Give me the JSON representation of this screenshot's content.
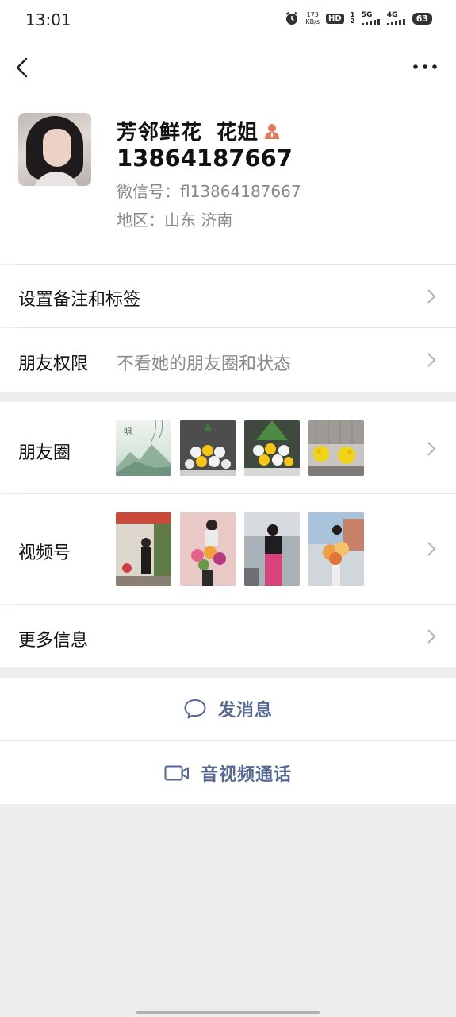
{
  "status_bar": {
    "time": "13:01",
    "net_speed_value": "173",
    "net_speed_unit": "KB/s",
    "hd_label": "HD",
    "hd_sub": "1 2",
    "signal1_label": "5G",
    "signal2_label": "4G",
    "battery": "63"
  },
  "nav": {
    "back_icon": "chevron-left-icon",
    "more_icon": "more-dots-icon"
  },
  "profile": {
    "name": "芳邻鲜花",
    "name_suffix": "花姐",
    "phone": "13864187667",
    "wechat_id": "微信号：fl13864187667",
    "region": "地区：山东  济南"
  },
  "rows": {
    "remark_label": "设置备注和标签",
    "permission_label": "朋友权限",
    "permission_value": "不看她的朋友圈和状态",
    "moments_label": "朋友圈",
    "channels_label": "视频号",
    "more_info_label": "更多信息"
  },
  "actions": {
    "message_label": "发消息",
    "call_label": "音视频通话"
  },
  "colors": {
    "accent": "#56688f",
    "background": "#ededed",
    "person_icon": "#e07b5c"
  }
}
